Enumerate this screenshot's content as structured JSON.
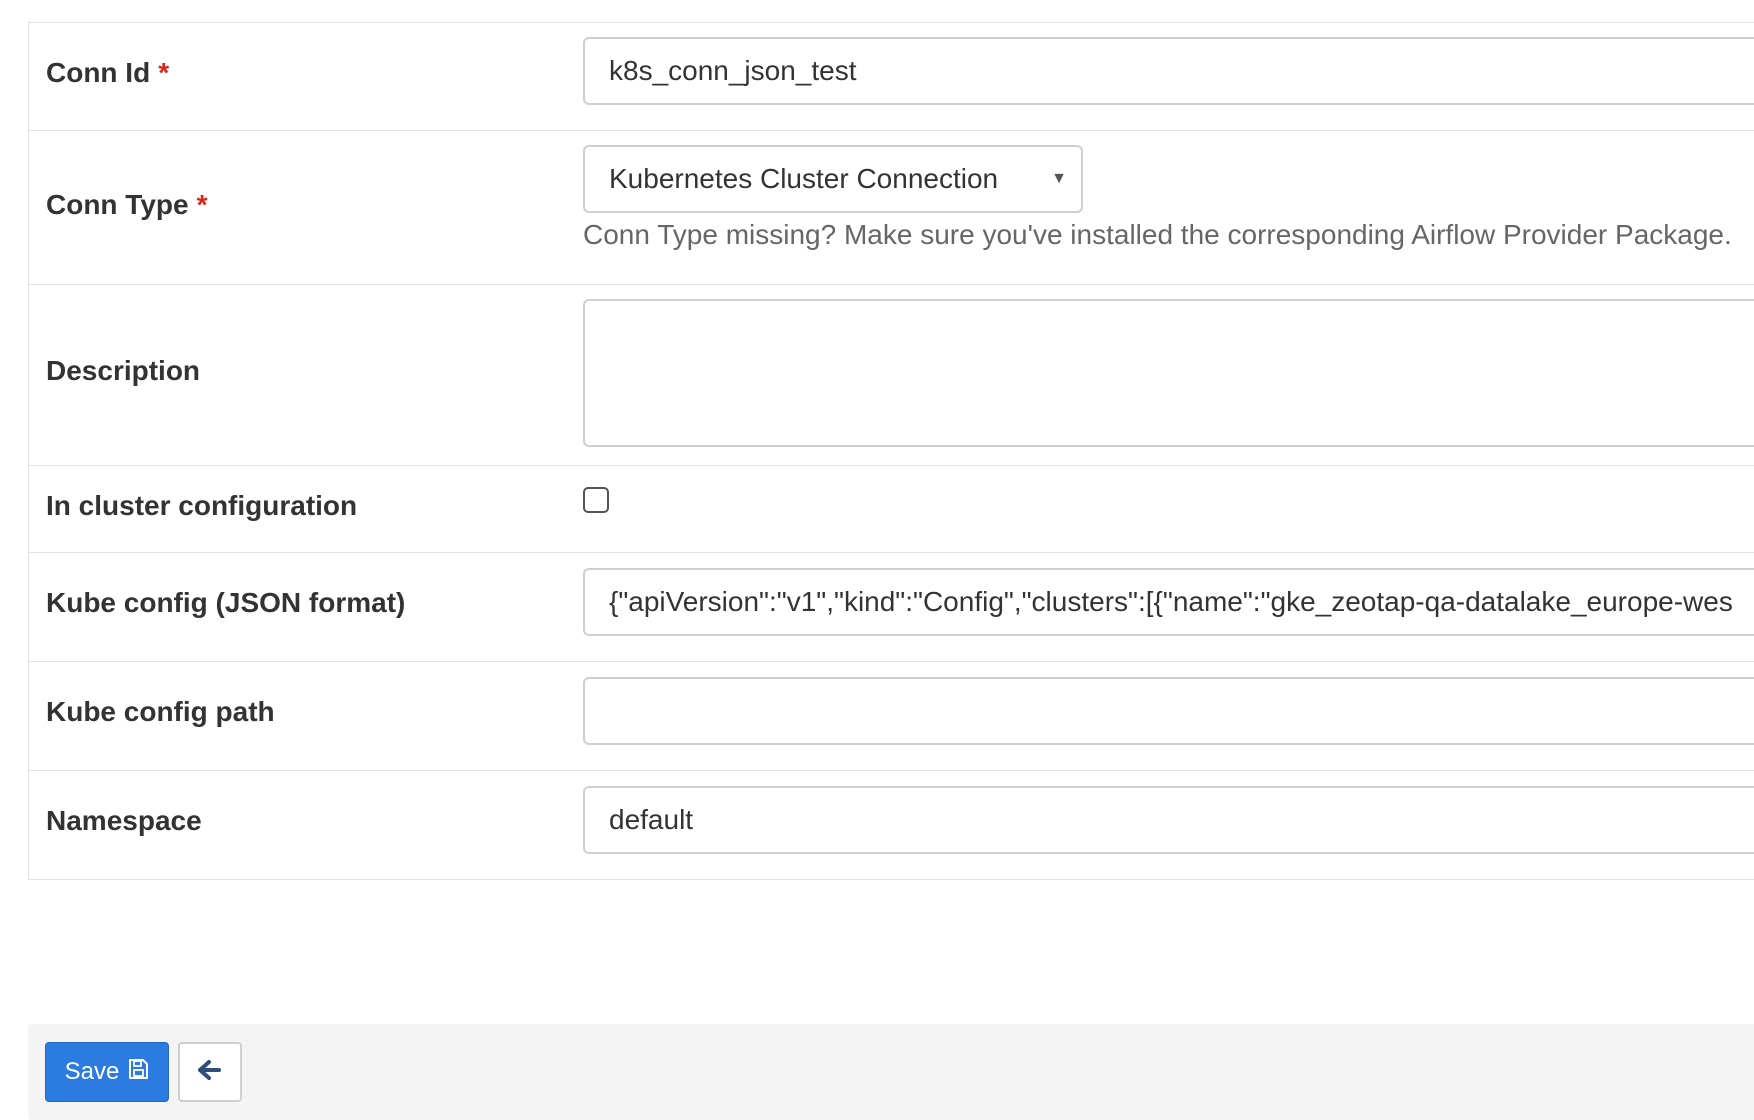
{
  "form": {
    "conn_id": {
      "label": "Conn Id",
      "required_mark": "*",
      "value": "k8s_conn_json_test"
    },
    "conn_type": {
      "label": "Conn Type",
      "required_mark": "*",
      "selected": "Kubernetes Cluster Connection",
      "help": "Conn Type missing? Make sure you've installed the corresponding Airflow Provider Package."
    },
    "description": {
      "label": "Description",
      "value": ""
    },
    "in_cluster": {
      "label": "In cluster configuration",
      "checked": false
    },
    "kube_config_json": {
      "label": "Kube config (JSON format)",
      "value": "{\"apiVersion\":\"v1\",\"kind\":\"Config\",\"clusters\":[{\"name\":\"gke_zeotap-qa-datalake_europe-wes"
    },
    "kube_config_path": {
      "label": "Kube config path",
      "value": ""
    },
    "namespace": {
      "label": "Namespace",
      "value": "default"
    }
  },
  "actions": {
    "save_label": "Save",
    "save_icon": "floppy-disk-icon",
    "back_icon": "arrow-left-icon"
  },
  "colors": {
    "primary": "#2c7be0",
    "required": "#d9241a",
    "border": "#cfcfcf",
    "action_bar": "#f4f4f4"
  }
}
